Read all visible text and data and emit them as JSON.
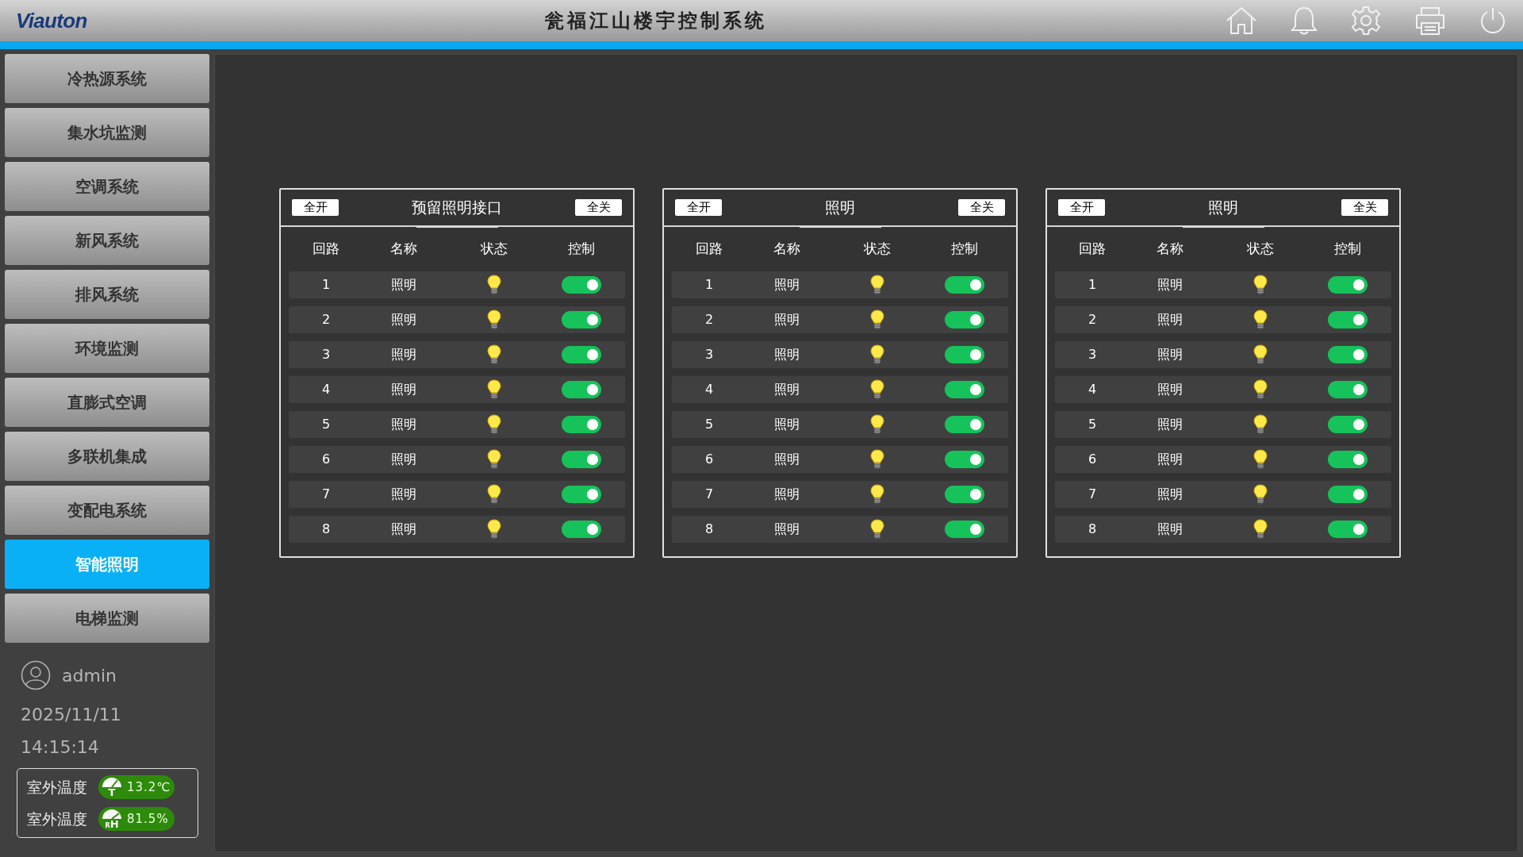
{
  "header": {
    "logo": "Viauton",
    "title": "瓮福江山楼宇控制系统"
  },
  "sidebar": {
    "items": [
      {
        "label": "冷热源系统",
        "selected": false
      },
      {
        "label": "集水坑监测",
        "selected": false
      },
      {
        "label": "空调系统",
        "selected": false
      },
      {
        "label": "新风系统",
        "selected": false
      },
      {
        "label": "排风系统",
        "selected": false
      },
      {
        "label": "环境监测",
        "selected": false
      },
      {
        "label": "直膨式空调",
        "selected": false
      },
      {
        "label": "多联机集成",
        "selected": false
      },
      {
        "label": "变配电系统",
        "selected": false
      },
      {
        "label": "智能照明",
        "selected": true
      },
      {
        "label": "电梯监测",
        "selected": false
      }
    ],
    "user": "admin",
    "date": "2025/11/11",
    "time": "14:15:14",
    "sensors": [
      {
        "label": "室外温度",
        "kind": "temperature",
        "icon_letter": "T",
        "value": "13.2℃"
      },
      {
        "label": "室外温度",
        "kind": "humidity",
        "icon_letter": "H",
        "icon_sub": "R",
        "value": "81.5%"
      }
    ]
  },
  "panels": [
    {
      "all_on": "全开",
      "title": "预留照明接口",
      "all_off": "全关",
      "columns": [
        "回路",
        "名称",
        "状态",
        "控制"
      ],
      "rows": [
        {
          "loop": "1",
          "name": "照明",
          "lit": true,
          "on": true
        },
        {
          "loop": "2",
          "name": "照明",
          "lit": true,
          "on": true
        },
        {
          "loop": "3",
          "name": "照明",
          "lit": true,
          "on": true
        },
        {
          "loop": "4",
          "name": "照明",
          "lit": true,
          "on": true
        },
        {
          "loop": "5",
          "name": "照明",
          "lit": true,
          "on": true
        },
        {
          "loop": "6",
          "name": "照明",
          "lit": true,
          "on": true
        },
        {
          "loop": "7",
          "name": "照明",
          "lit": true,
          "on": true
        },
        {
          "loop": "8",
          "name": "照明",
          "lit": true,
          "on": true
        }
      ]
    },
    {
      "all_on": "全开",
      "title": "照明",
      "all_off": "全关",
      "columns": [
        "回路",
        "名称",
        "状态",
        "控制"
      ],
      "rows": [
        {
          "loop": "1",
          "name": "照明",
          "lit": true,
          "on": true
        },
        {
          "loop": "2",
          "name": "照明",
          "lit": true,
          "on": true
        },
        {
          "loop": "3",
          "name": "照明",
          "lit": true,
          "on": true
        },
        {
          "loop": "4",
          "name": "照明",
          "lit": true,
          "on": true
        },
        {
          "loop": "5",
          "name": "照明",
          "lit": true,
          "on": true
        },
        {
          "loop": "6",
          "name": "照明",
          "lit": true,
          "on": true
        },
        {
          "loop": "7",
          "name": "照明",
          "lit": true,
          "on": true
        },
        {
          "loop": "8",
          "name": "照明",
          "lit": true,
          "on": true
        }
      ]
    },
    {
      "all_on": "全开",
      "title": "照明",
      "all_off": "全关",
      "columns": [
        "回路",
        "名称",
        "状态",
        "控制"
      ],
      "rows": [
        {
          "loop": "1",
          "name": "照明",
          "lit": true,
          "on": true
        },
        {
          "loop": "2",
          "name": "照明",
          "lit": true,
          "on": true
        },
        {
          "loop": "3",
          "name": "照明",
          "lit": true,
          "on": true
        },
        {
          "loop": "4",
          "name": "照明",
          "lit": true,
          "on": true
        },
        {
          "loop": "5",
          "name": "照明",
          "lit": true,
          "on": true
        },
        {
          "loop": "6",
          "name": "照明",
          "lit": true,
          "on": true
        },
        {
          "loop": "7",
          "name": "照明",
          "lit": true,
          "on": true
        },
        {
          "loop": "8",
          "name": "照明",
          "lit": true,
          "on": true
        }
      ]
    }
  ]
}
